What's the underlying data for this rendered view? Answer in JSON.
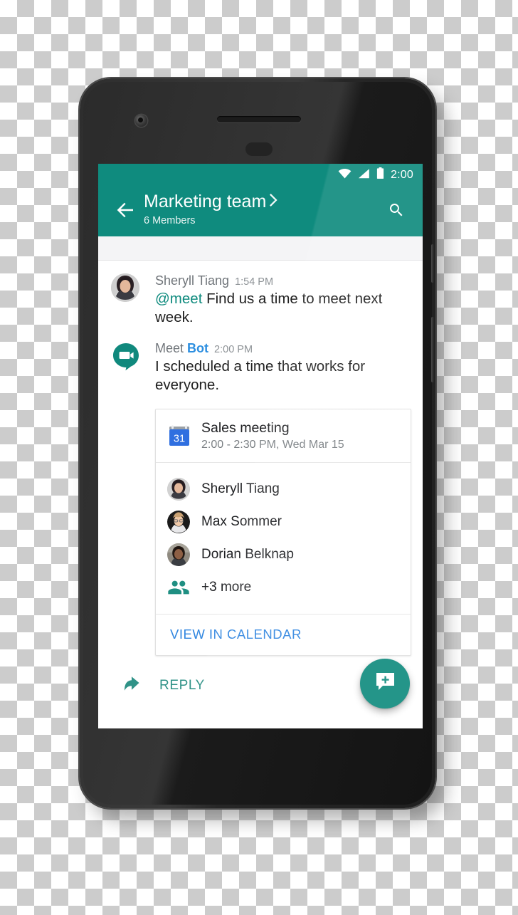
{
  "device": {
    "name": "android-smartphone-mockup",
    "front_camera": "camera-icon",
    "earpiece": "speaker-grille"
  },
  "status_bar": {
    "wifi_icon": "wifi-icon",
    "signal_icon": "cell-signal-icon",
    "battery_icon": "battery-icon",
    "time": "2:00"
  },
  "app_bar": {
    "back_icon": "arrow-left-icon",
    "title": "Marketing team",
    "title_chevron_icon": "chevron-right-icon",
    "subtitle": "6 Members",
    "search_icon": "search-icon",
    "background_color": "#0f8b7e"
  },
  "thread": {
    "messages": [
      {
        "avatar": "avatar-sheryll-tiang",
        "sender": "Sheryll Tiang",
        "timestamp": "1:54 PM",
        "mention": "@meet",
        "text": " Find us a time to meet next week."
      },
      {
        "avatar": "meet-bot-icon",
        "sender_prefix": "Meet ",
        "sender_highlight": "Bot",
        "timestamp": "2:00 PM",
        "text": "I scheduled a time that works for everyone."
      }
    ]
  },
  "event_card": {
    "calendar_icon": "google-calendar-icon",
    "calendar_icon_day": "31",
    "title": "Sales meeting",
    "when": "2:00 - 2:30 PM, Wed Mar 15",
    "attendees": [
      {
        "avatar": "avatar-sheryll-tiang",
        "name": "Sheryll Tiang"
      },
      {
        "avatar": "avatar-max-sommer",
        "name": "Max Sommer"
      },
      {
        "avatar": "avatar-dorian-belknap",
        "name": "Dorian Belknap"
      }
    ],
    "overflow": {
      "icon": "people-group-icon",
      "label": "+3 more"
    },
    "action_label": "VIEW IN CALENDAR",
    "action_color": "#3086e0"
  },
  "footer": {
    "reply_icon": "reply-arrow-icon",
    "reply_label": "REPLY",
    "fab_icon": "new-chat-plus-icon",
    "fab_color": "#0f8b7e"
  }
}
